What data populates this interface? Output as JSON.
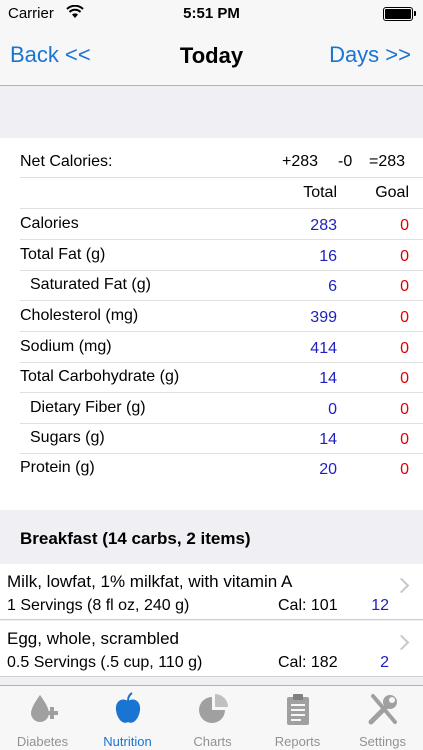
{
  "status": {
    "carrier": "Carrier",
    "time": "5:51 PM"
  },
  "nav": {
    "back": "Back  <<",
    "title": "Today",
    "days": "Days  >>"
  },
  "net": {
    "label": "Net Calories:",
    "plus": "+283",
    "minus": "-0",
    "total": "=283"
  },
  "headers": {
    "total": "Total",
    "goal": "Goal"
  },
  "nutrients": [
    {
      "label": "Calories",
      "total": "283",
      "goal": "0"
    },
    {
      "label": "Total Fat (g)",
      "total": "16",
      "goal": "0"
    },
    {
      "label": "Saturated Fat (g)",
      "total": "6",
      "goal": "0"
    },
    {
      "label": "Cholesterol (mg)",
      "total": "399",
      "goal": "0"
    },
    {
      "label": "Sodium (mg)",
      "total": "414",
      "goal": "0"
    },
    {
      "label": "Total Carbohydrate (g)",
      "total": "14",
      "goal": "0"
    },
    {
      "label": "Dietary Fiber (g)",
      "total": "0",
      "goal": "0"
    },
    {
      "label": "Sugars (g)",
      "total": "14",
      "goal": "0"
    },
    {
      "label": "Protein (g)",
      "total": "20",
      "goal": "0"
    }
  ],
  "section": {
    "title": "Breakfast (14 carbs, 2 items)"
  },
  "items": [
    {
      "name": "Milk, lowfat, 1% milkfat, with vitamin A",
      "servings": "1 Servings (8 fl oz, 240 g)",
      "cal": "Cal: 101",
      "carbs": "12"
    },
    {
      "name": "Egg, whole, scrambled",
      "servings": "0.5 Servings (.5 cup, 110 g)",
      "cal": "Cal: 182",
      "carbs": "2"
    }
  ],
  "tabs": [
    {
      "label": "Diabetes",
      "icon": "diabetes-icon"
    },
    {
      "label": "Nutrition",
      "icon": "apple-icon"
    },
    {
      "label": "Charts",
      "icon": "pie-chart-icon"
    },
    {
      "label": "Reports",
      "icon": "clipboard-icon"
    },
    {
      "label": "Settings",
      "icon": "tools-icon"
    }
  ],
  "colors": {
    "accent": "#1a75d2",
    "total": "#1f1fbf",
    "goal": "#e00000",
    "inactive": "#929292"
  }
}
